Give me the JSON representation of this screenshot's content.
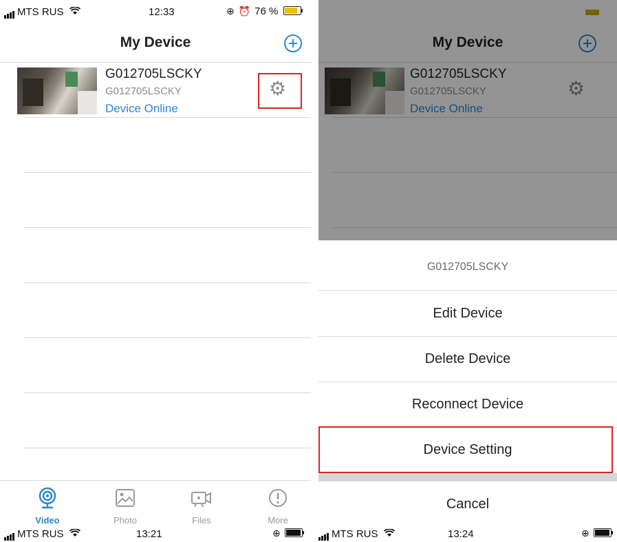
{
  "left_screen": {
    "status_bar": {
      "carrier": "MTS RUS",
      "time": "12:33",
      "battery_text": "76 %",
      "battery_level": 0.76
    },
    "nav": {
      "title": "My Device"
    },
    "device": {
      "name": "G012705LSCKY",
      "id": "G012705LSCKY",
      "status": "Device Online"
    },
    "tabs": [
      {
        "label": "Video",
        "icon": "webcam-icon"
      },
      {
        "label": "Photo",
        "icon": "photo-icon"
      },
      {
        "label": "Files",
        "icon": "video-camera-icon"
      },
      {
        "label": "More",
        "icon": "info-icon"
      }
    ],
    "bottom_status": {
      "carrier": "MTS RUS",
      "time": "13:21"
    }
  },
  "right_screen": {
    "nav": {
      "title": "My Device"
    },
    "device": {
      "name": "G012705LSCKY",
      "id": "G012705LSCKY",
      "status": "Device Online"
    },
    "action_sheet": {
      "title": "G012705LSCKY",
      "items": [
        "Edit Device",
        "Delete Device",
        "Reconnect Device",
        "Device Setting"
      ],
      "cancel": "Cancel"
    },
    "bottom_status": {
      "carrier": "MTS RUS",
      "time": "13:24"
    }
  },
  "colors": {
    "accent": "#2a86d4",
    "highlight": "#dd2222"
  }
}
